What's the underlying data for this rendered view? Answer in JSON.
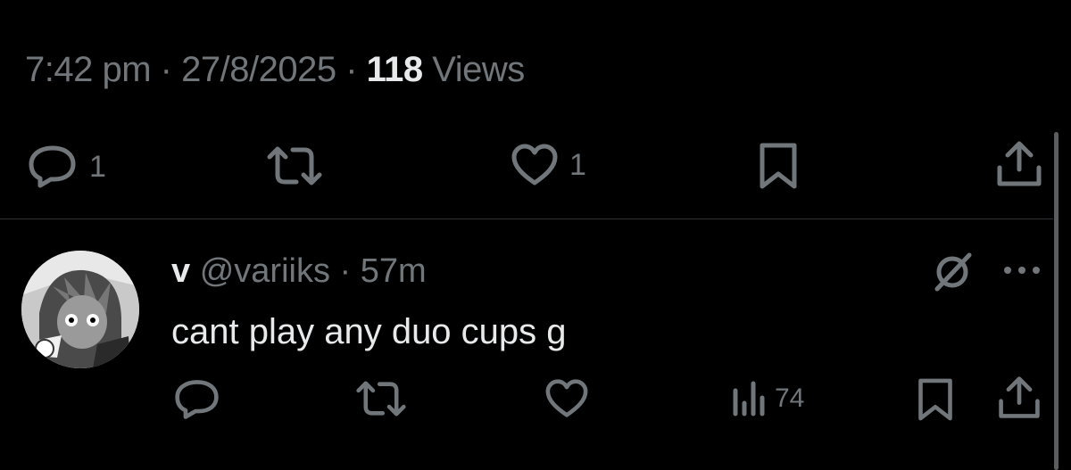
{
  "post": {
    "time": "7:42 pm",
    "separator": "·",
    "date": "27/8/2025",
    "views_count": "118",
    "views_label": "Views",
    "actions": {
      "reply_count": "1",
      "like_count": "1"
    }
  },
  "reply": {
    "name": "v",
    "handle": "@variiks",
    "separator": "·",
    "time": "57m",
    "text": "cant play any duo cups g",
    "actions": {
      "views_count": "74"
    }
  },
  "icons": {
    "reply": "reply-icon",
    "retweet": "retweet-icon",
    "like": "heart-icon",
    "bookmark": "bookmark-icon",
    "share": "share-icon",
    "grok": "grok-icon",
    "more": "more-icon",
    "views": "views-icon"
  },
  "colors": {
    "background": "#000000",
    "primary_text": "#e7e9ea",
    "secondary_text": "#71767b",
    "divider": "#2f3336"
  }
}
